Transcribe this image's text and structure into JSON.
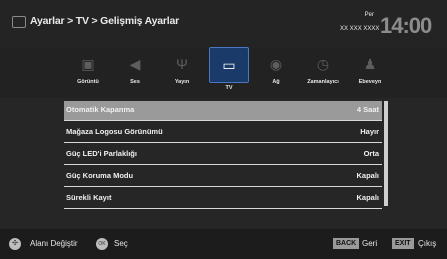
{
  "header": {
    "breadcrumb": "Ayarlar > TV > Gelişmiş Ayarlar",
    "day": "Per",
    "date": "XX XXX XXXX",
    "clock": "14:00"
  },
  "tabs": [
    {
      "label": "Görüntü",
      "icon": "picture-icon"
    },
    {
      "label": "Ses",
      "icon": "speaker-icon"
    },
    {
      "label": "Yayın",
      "icon": "antenna-icon"
    },
    {
      "label": "TV",
      "icon": "tv-icon",
      "active": true
    },
    {
      "label": "Ağ",
      "icon": "network-icon"
    },
    {
      "label": "Zamanlayıcı",
      "icon": "timer-icon"
    },
    {
      "label": "Ebeveyn",
      "icon": "parental-icon"
    }
  ],
  "settings": [
    {
      "label": "Otomatik Kapanma",
      "value": "4 Saat",
      "selected": true
    },
    {
      "label": "Mağaza Logosu Görünümü",
      "value": "Hayır"
    },
    {
      "label": "Güç LED'i Parlaklığı",
      "value": "Orta"
    },
    {
      "label": "Güç Koruma Modu",
      "value": "Kapalı"
    },
    {
      "label": "Sürekli Kayıt",
      "value": "Kapalı"
    }
  ],
  "footer": {
    "navigate_icon": "dpad-icon",
    "navigate_label": "Alanı Değiştir",
    "ok_icon": "ok-icon",
    "ok_key": "OK",
    "ok_label": "Seç",
    "back_key": "BACK",
    "back_label": "Geri",
    "exit_key": "EXIT",
    "exit_label": "Çıkış"
  },
  "colors": {
    "background": "#262626",
    "selected_row": "#9a9a9a",
    "active_tab": "#1a3a6a"
  }
}
